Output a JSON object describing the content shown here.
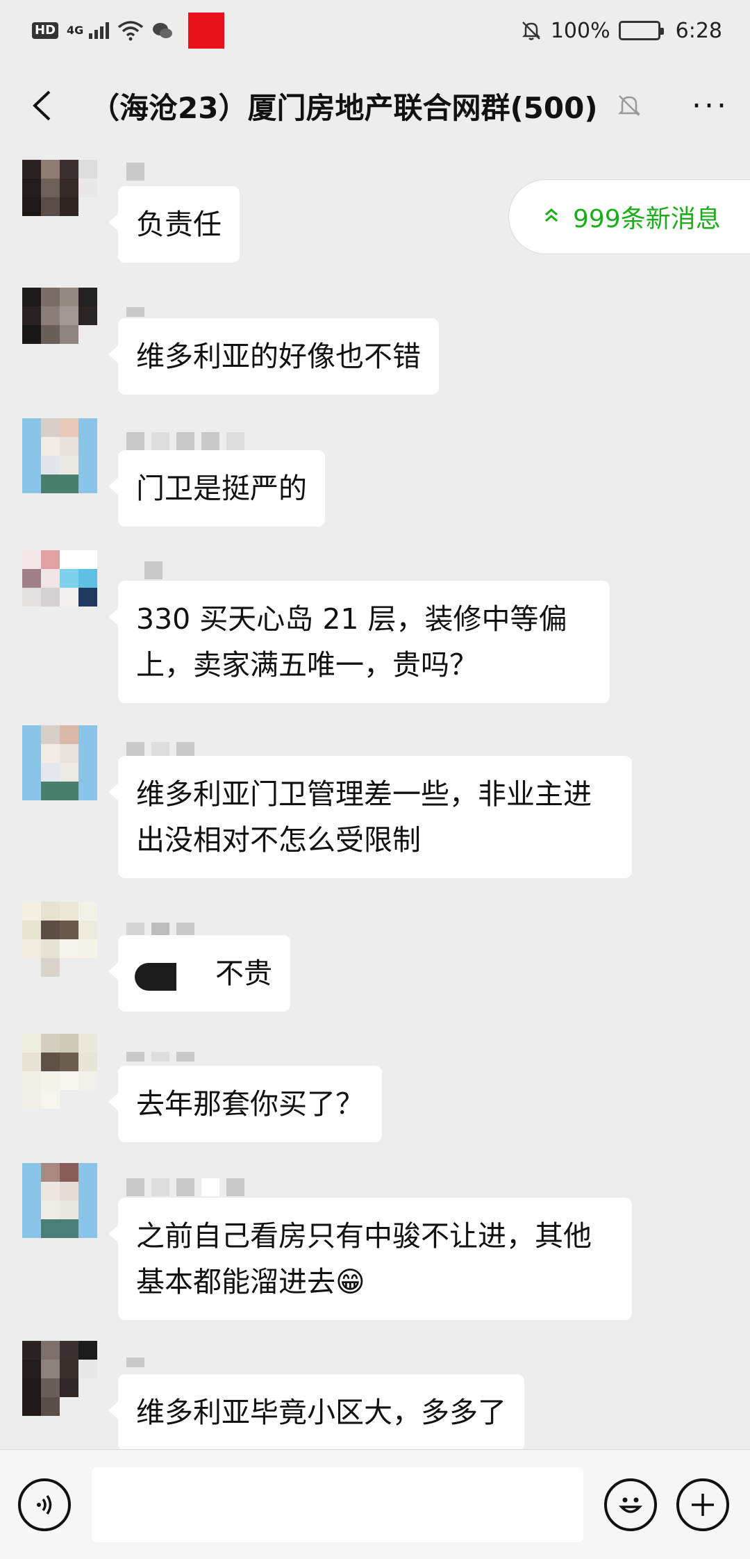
{
  "status_bar": {
    "hd": "HD",
    "network": "4G",
    "battery_percent": "100%",
    "time": "6:28"
  },
  "header": {
    "back_icon": "back-chevron",
    "title": "（海沧23）厦门房地产联合网群(500)",
    "mute_icon": "bell-off-icon",
    "more_label": "···"
  },
  "new_messages": {
    "label": "999条新消息"
  },
  "messages": [
    {
      "text": "负责任"
    },
    {
      "text": "维多利亚的好像也不错"
    },
    {
      "text": "门卫是挺严的"
    },
    {
      "text": "330 买天心岛 21 层，装修中等偏上，卖家满五唯一，贵吗？"
    },
    {
      "text": "维多利亚门卫管理差一些，非业主进出没相对不怎么受限制"
    },
    {
      "text": "不贵"
    },
    {
      "text": "去年那套你买了？"
    },
    {
      "text": "之前自己看房只有中骏不让进，其他基本都能溜进去😁"
    },
    {
      "text": "维多利亚毕竟小区大，多多了"
    }
  ],
  "input_bar": {
    "voice_icon": "voice-icon",
    "emoji_icon": "emoji-icon",
    "plus_icon": "plus-icon"
  }
}
